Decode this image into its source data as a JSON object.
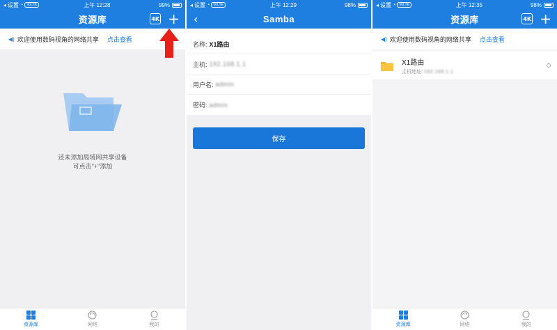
{
  "panel1": {
    "status": {
      "carrier": "设置",
      "time": "上午 12:28",
      "battery": "99%",
      "volte": "VoLTE"
    },
    "title": "资源库",
    "shield_glyph": "4K",
    "plus_glyph": "+",
    "notice": {
      "text": "欢迎使用数码视角的网络共享",
      "link": "点击查看"
    },
    "empty_line1": "还未添加局域网共享设备",
    "empty_line2": "可点击\"+\"添加"
  },
  "panel2": {
    "status": {
      "carrier": "设置",
      "time": "上午 12:29",
      "battery": "98%",
      "volte": "VoLTE"
    },
    "title": "Samba",
    "back_glyph": "‹",
    "fields": [
      {
        "label": "名称:",
        "value": "X1路由"
      },
      {
        "label": "主机:",
        "value": "192.168.1.1"
      },
      {
        "label": "用户名:",
        "value": "admin"
      },
      {
        "label": "密码:",
        "value": "admin"
      }
    ],
    "save_label": "保存"
  },
  "panel3": {
    "status": {
      "carrier": "设置",
      "time": "上午 12:35",
      "battery": "98%",
      "volte": "VoLTE"
    },
    "title": "资源库",
    "shield_glyph": "4K",
    "plus_glyph": "+",
    "notice": {
      "text": "欢迎使用数码视角的网络共享",
      "link": "点击查看"
    },
    "device": {
      "name": "X1路由",
      "sub_label": "主机地址:",
      "sub_value": "192.168.1.1"
    }
  },
  "tabs": [
    {
      "label": "资源库",
      "icon": "grid-icon"
    },
    {
      "label": "网络",
      "icon": "network-icon"
    },
    {
      "label": "我的",
      "icon": "user-icon"
    }
  ],
  "colors": {
    "accent": "#1e7fe0",
    "arrow": "#e8201a"
  }
}
